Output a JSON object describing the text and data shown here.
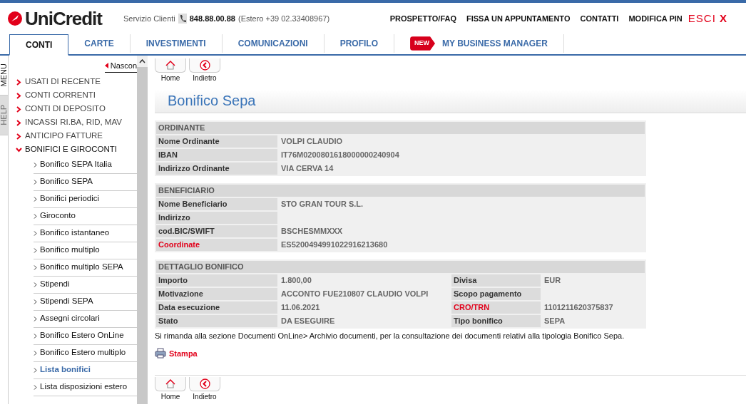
{
  "header": {
    "logo": "UniCredit",
    "service_label": "Servizio Clienti",
    "service_phone": "848.88.00.88",
    "service_abroad": "(Estero +39 02.33408967)",
    "links": [
      "PROSPETTO/FAQ",
      "FISSA UN APPUNTAMENTO",
      "CONTATTI",
      "MODIFICA PIN"
    ],
    "logout": {
      "label": "ESCI",
      "icon": "X"
    }
  },
  "tabs": [
    {
      "label": "CONTI",
      "selected": true
    },
    {
      "label": "CARTE",
      "selected": false
    },
    {
      "label": "INVESTIMENTI",
      "selected": false
    },
    {
      "label": "COMUNICAZIONI",
      "selected": false
    },
    {
      "label": "PROFILO",
      "selected": false
    },
    {
      "label": "MY BUSINESS MANAGER",
      "selected": false,
      "badge": "NEW"
    }
  ],
  "side_tabs": [
    "MENU",
    "HELP"
  ],
  "sidebar": {
    "hide_link": "Nascon",
    "sections": [
      {
        "label": "USATI DI RECENTE",
        "expanded": false
      },
      {
        "label": "CONTI CORRENTI",
        "expanded": false
      },
      {
        "label": "CONTI DI DEPOSITO",
        "expanded": false
      },
      {
        "label": "INCASSI RI.BA, RID, MAV",
        "expanded": false
      },
      {
        "label": "ANTICIPO FATTURE",
        "expanded": false
      },
      {
        "label": "BONIFICI E GIROCONTI",
        "expanded": true,
        "children": [
          {
            "label": "Bonifico SEPA Italia",
            "selected": false
          },
          {
            "label": "Bonifico SEPA",
            "selected": false
          },
          {
            "label": "Bonifici periodici",
            "selected": false
          },
          {
            "label": "Giroconto",
            "selected": false
          },
          {
            "label": "Bonifico istantaneo",
            "selected": false
          },
          {
            "label": "Bonifico multiplo",
            "selected": false
          },
          {
            "label": "Bonifico multiplo SEPA",
            "selected": false
          },
          {
            "label": "Stipendi",
            "selected": false
          },
          {
            "label": "Stipendi SEPA",
            "selected": false
          },
          {
            "label": "Assegni circolari",
            "selected": false
          },
          {
            "label": "Bonifico Estero OnLine",
            "selected": false
          },
          {
            "label": "Bonifico Estero multiplo",
            "selected": false
          },
          {
            "label": "Lista bonifici",
            "selected": true
          },
          {
            "label": "Lista disposizioni estero",
            "selected": false
          }
        ]
      }
    ]
  },
  "toolbar_top": [
    {
      "kind": "home",
      "label": "Home"
    },
    {
      "kind": "back",
      "label": "Indietro"
    }
  ],
  "page_title": "Bonifico Sepa",
  "sections": [
    {
      "title": "ORDINANTE",
      "rows": [
        [
          {
            "label": "Nome Ordinante",
            "highlight": false,
            "value": "VOLPI CLAUDIO"
          }
        ],
        [
          {
            "label": "IBAN",
            "highlight": false,
            "value": "IT76M0200801618000000240904"
          }
        ],
        [
          {
            "label": "Indirizzo Ordinante",
            "highlight": false,
            "value": "VIA CERVA 14"
          }
        ]
      ]
    },
    {
      "title": "BENEFICIARIO",
      "rows": [
        [
          {
            "label": "Nome Beneficiario",
            "highlight": false,
            "value": "STO GRAN TOUR S.L."
          }
        ],
        [
          {
            "label": "Indirizzo",
            "highlight": false
          }
        ],
        [
          {
            "label": "cod.BIC/SWIFT",
            "highlight": false,
            "value": "BSCHESMMXXX"
          }
        ],
        [
          {
            "label": "Coordinate",
            "highlight": true,
            "value": "ES5200494991022916213680"
          }
        ]
      ]
    },
    {
      "title": "DETTAGLIO BONIFICO",
      "rows": [
        [
          {
            "label": "Importo",
            "highlight": false,
            "value": "1.800,00"
          },
          {
            "label": "Divisa",
            "highlight": false,
            "value": "EUR"
          }
        ],
        [
          {
            "label": "Motivazione",
            "highlight": false,
            "value": "ACCONTO FUE210807 CLAUDIO VOLPI"
          },
          {
            "label": "Scopo pagamento",
            "highlight": false
          }
        ],
        [
          {
            "label": "Data esecuzione",
            "highlight": false,
            "value": "11.06.2021"
          },
          {
            "label": "CRO/TRN",
            "highlight": true,
            "value": "1101211620375837"
          }
        ],
        [
          {
            "label": "Stato",
            "highlight": false,
            "value": "DA ESEGUIRE"
          },
          {
            "label": "Tipo bonifico",
            "highlight": false,
            "value": "SEPA"
          }
        ]
      ]
    }
  ],
  "note": "Si rimanda alla sezione Documenti OnLine> Archivio documenti, per la consultazione dei documenti relativi alla tipologia Bonifico Sepa.",
  "print_link": "Stampa",
  "toolbar_bottom": [
    {
      "kind": "home",
      "label": "Home"
    },
    {
      "kind": "back",
      "label": "Indietro"
    }
  ]
}
